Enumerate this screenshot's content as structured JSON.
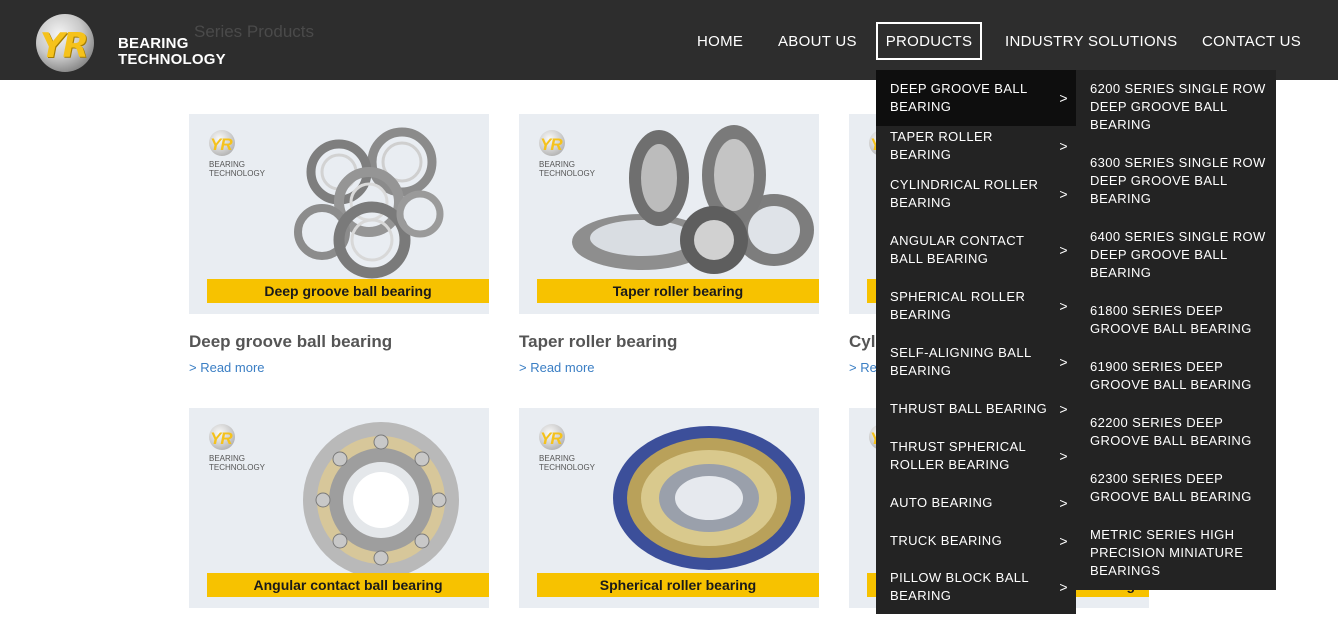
{
  "header": {
    "logo_mark": "YR",
    "logo_line1": "BEARING",
    "logo_line2": "TECHNOLOGY",
    "faded_title": "Series Products",
    "nav": [
      "HOME",
      "ABOUT US",
      "PRODUCTS",
      "INDUSTRY SOLUTIONS",
      "CONTACT US"
    ],
    "active_nav": "PRODUCTS"
  },
  "brand": {
    "mini_logo_mark": "YR",
    "mini_logo_line1": "BEARING",
    "mini_logo_line2": "TECHNOLOGY"
  },
  "products": [
    {
      "banner": "Deep groove ball bearing",
      "title": "Deep groove ball bearing",
      "link": "> Read more"
    },
    {
      "banner": "Taper roller bearing",
      "title": "Taper roller bearing",
      "link": "> Read more"
    },
    {
      "banner": "",
      "title": "Cyli",
      "link": "> Re"
    },
    {
      "banner": "Angular contact ball bearing",
      "title": "",
      "link": ""
    },
    {
      "banner": "Spherical roller bearing",
      "title": "",
      "link": ""
    },
    {
      "banner": "g",
      "title": "",
      "link": ""
    }
  ],
  "dropdown": {
    "categories": [
      "DEEP GROOVE BALL BEARING",
      "TAPER ROLLER BEARING",
      "CYLINDRICAL ROLLER BEARING",
      "ANGULAR CONTACT BALL BEARING",
      "SPHERICAL ROLLER BEARING",
      "SELF-ALIGNING BALL BEARING",
      "THRUST BALL BEARING",
      "THRUST SPHERICAL ROLLER BEARING",
      "AUTO BEARING",
      "TRUCK BEARING",
      "PILLOW BLOCK BALL BEARING"
    ],
    "active_category": "DEEP GROOVE BALL BEARING",
    "subitems": [
      "6200 SERIES SINGLE ROW DEEP GROOVE BALL BEARING",
      "6300 SERIES SINGLE ROW DEEP GROOVE BALL BEARING",
      "6400 SERIES SINGLE ROW DEEP GROOVE BALL BEARING",
      "61800 SERIES DEEP GROOVE BALL BEARING",
      "61900 SERIES DEEP GROOVE BALL BEARING",
      "62200 SERIES DEEP GROOVE BALL BEARING",
      "62300 SERIES DEEP GROOVE BALL BEARING",
      "METRIC SERIES HIGH PRECISION MINIATURE BEARINGS"
    ],
    "chevron": ">"
  },
  "colors": {
    "header_bg": "#2d2d2d",
    "menu_bg": "#232323",
    "accent_yellow": "#f7c200",
    "link_blue": "#3a7ec4"
  }
}
